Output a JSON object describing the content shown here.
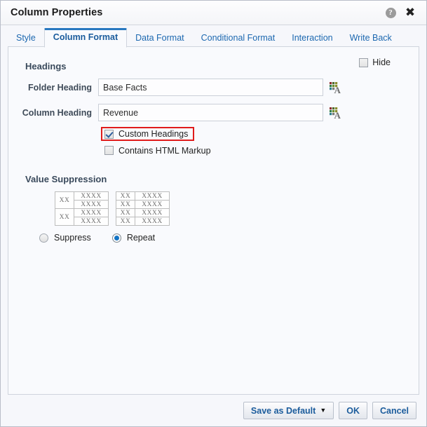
{
  "window": {
    "title": "Column Properties",
    "help_icon": "help-circle-icon",
    "close_icon": "close-x-icon",
    "help_glyph": "?",
    "close_glyph": "✖"
  },
  "tabs": [
    {
      "label": "Style",
      "active": false
    },
    {
      "label": "Column Format",
      "active": true
    },
    {
      "label": "Data Format",
      "active": false
    },
    {
      "label": "Conditional Format",
      "active": false
    },
    {
      "label": "Interaction",
      "active": false
    },
    {
      "label": "Write Back",
      "active": false
    }
  ],
  "headings": {
    "section_title": "Headings",
    "hide_checkbox": {
      "label": "Hide",
      "checked": false
    },
    "folder_heading": {
      "label": "Folder Heading",
      "value": "Base Facts",
      "placeholder": ""
    },
    "column_heading": {
      "label": "Column Heading",
      "value": "Revenue",
      "placeholder": ""
    },
    "font_icon_name": "font-format-icon",
    "custom_headings": {
      "label": "Custom Headings",
      "checked": true,
      "highlighted": true
    },
    "contains_html": {
      "label": "Contains HTML Markup",
      "checked": false
    }
  },
  "value_suppression": {
    "section_title": "Value Suppression",
    "suppress_table": {
      "name": "suppress-preview-table",
      "rows": [
        {
          "xx": "XX",
          "xx_rowspan": 2,
          "xxxx": "XXXX"
        },
        {
          "xx": null,
          "xxxx": "XXXX"
        },
        {
          "xx": "XX",
          "xx_rowspan": 2,
          "xxxx": "XXXX"
        },
        {
          "xx": null,
          "xxxx": "XXXX"
        }
      ]
    },
    "repeat_table": {
      "name": "repeat-preview-table",
      "rows": [
        {
          "xx": "XX",
          "xxxx": "XXXX"
        },
        {
          "xx": "XX",
          "xxxx": "XXXX"
        },
        {
          "xx": "XX",
          "xxxx": "XXXX"
        },
        {
          "xx": "XX",
          "xxxx": "XXXX"
        }
      ]
    },
    "options": [
      {
        "label": "Suppress",
        "selected": false
      },
      {
        "label": "Repeat",
        "selected": true
      }
    ]
  },
  "footer": {
    "save_as_default": "Save as Default",
    "save_caret": "▼",
    "ok": "OK",
    "cancel": "Cancel"
  },
  "colors": {
    "accent_blue": "#2878c0",
    "link_blue": "#1c68b0",
    "highlight_red": "#e01b1b",
    "radio_fill": "#1273c4",
    "panel_bg": "#f9fafd",
    "dialog_bg": "#f6f7fb"
  }
}
